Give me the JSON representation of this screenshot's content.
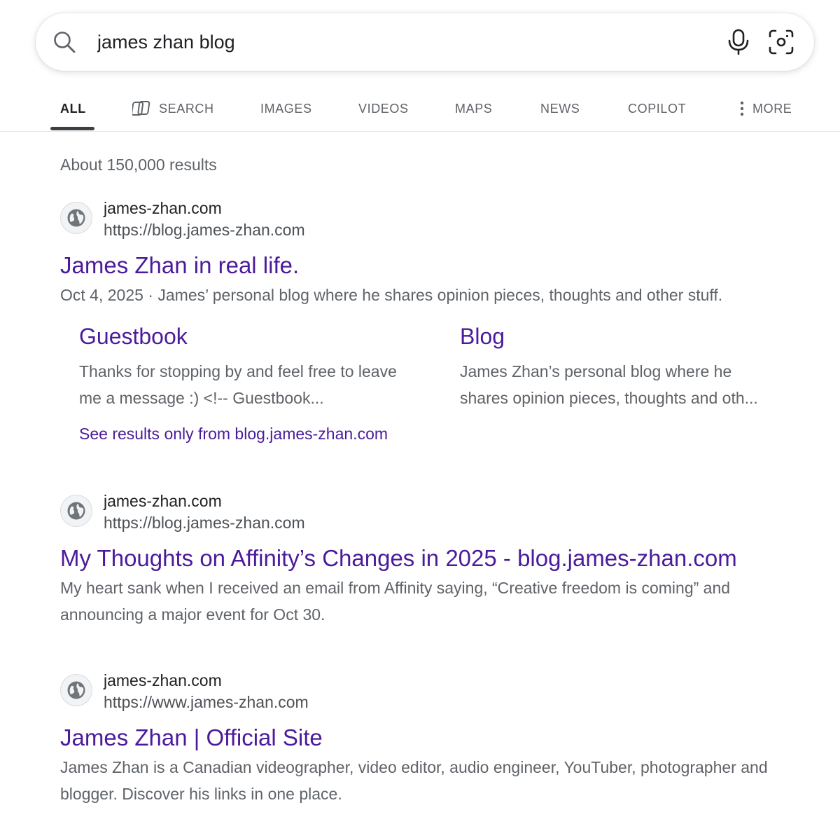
{
  "search": {
    "query": "james zhan blog"
  },
  "tabs": [
    {
      "label": "ALL"
    },
    {
      "label": "SEARCH"
    },
    {
      "label": "IMAGES"
    },
    {
      "label": "VIDEOS"
    },
    {
      "label": "MAPS"
    },
    {
      "label": "NEWS"
    },
    {
      "label": "COPILOT"
    },
    {
      "label": "MORE"
    }
  ],
  "results_count": "About 150,000 results",
  "results": [
    {
      "site_name": "james-zhan.com",
      "url": "https://blog.james-zhan.com",
      "title": "James Zhan in real life.",
      "date": "Oct 4, 2025",
      "separator": " · ",
      "snippet": "James’ personal blog where he shares opinion pieces, thoughts and other stuff.",
      "sitelinks": [
        {
          "title": "Guestbook",
          "description": "Thanks for stopping by and feel free to leave me a message :) <!-- Guestbook..."
        },
        {
          "title": "Blog",
          "description": "James Zhan’s personal blog where he shares opinion pieces, thoughts and oth..."
        }
      ],
      "see_more": "See results only from blog.james-zhan.com"
    },
    {
      "site_name": "james-zhan.com",
      "url": "https://blog.james-zhan.com",
      "title": "My Thoughts on Affinity’s Changes in 2025 - blog.james-zhan.com",
      "snippet": "My heart sank when I received an email from Affinity saying, “Creative freedom is coming” and announcing a major event for Oct 30."
    },
    {
      "site_name": "james-zhan.com",
      "url": "https://www.james-zhan.com",
      "title": "James Zhan | Official Site",
      "snippet": "James Zhan is a Canadian videographer, video editor, audio engineer, YouTuber, photographer and blogger. Discover his links in one place."
    }
  ],
  "colors": {
    "link": "#4b1b9b",
    "muted": "#5f6368",
    "text": "#202124"
  },
  "icons": {
    "search": "search-icon",
    "mic": "microphone-icon",
    "lens": "visual-search-icon",
    "copilot": "copilot-icon",
    "more": "vertical-dots-icon",
    "favicon": "globe-icon"
  }
}
